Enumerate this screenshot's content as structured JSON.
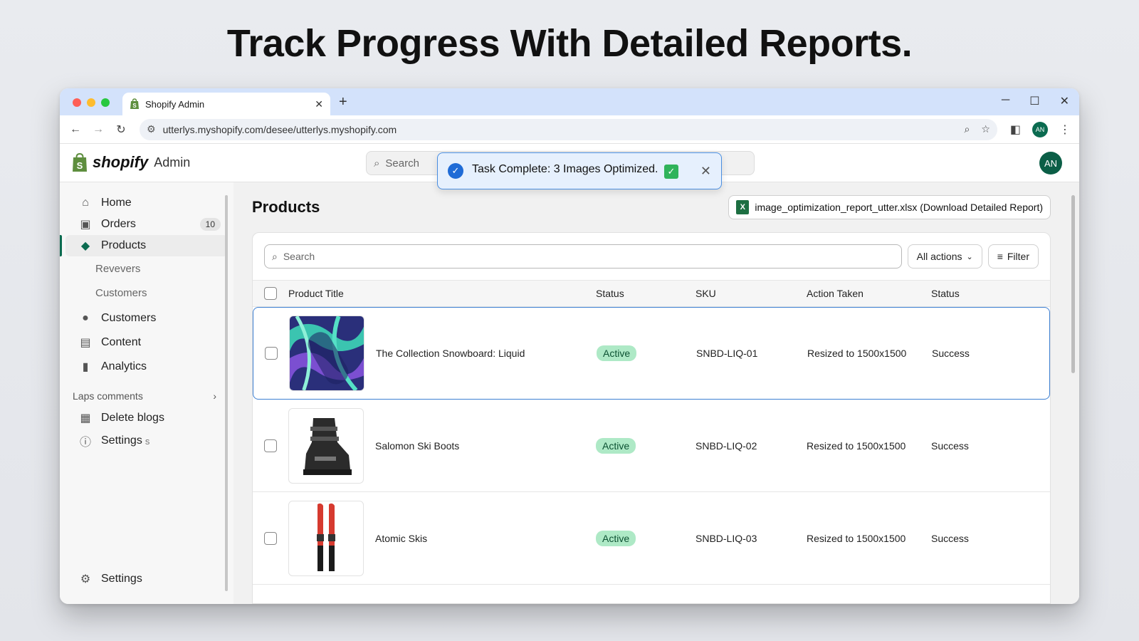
{
  "headline": "Track Progress With Detailed Reports.",
  "browser": {
    "tab_title": "Shopify Admin",
    "url": "utterlys.myshopify.com/desee/utterlys.myshopify.com",
    "profile_initials": "AN"
  },
  "header": {
    "logo_word": "shopify",
    "logo_suffix": "Admin",
    "search_placeholder": "Search",
    "avatar_initials": "AN"
  },
  "toast": {
    "message": "Task Complete: 3 Images Optimized.",
    "emoji": "✓"
  },
  "sidebar": {
    "items": [
      {
        "label": "Home",
        "icon": "home-icon"
      },
      {
        "label": "Orders",
        "icon": "inbox-icon",
        "badge": "10"
      },
      {
        "label": "Products",
        "icon": "tag-icon",
        "active": true
      }
    ],
    "sub_items": [
      "Revevers",
      "Customers"
    ],
    "items2": [
      {
        "label": "Customers",
        "icon": "person-icon"
      },
      {
        "label": "Content",
        "icon": "content-icon"
      },
      {
        "label": "Analytics",
        "icon": "bar-chart-icon"
      }
    ],
    "section_title": "Laps comments",
    "section_items": [
      {
        "label": "Delete blogs",
        "icon": "blog-icon"
      },
      {
        "label": "Settings",
        "suffix": "s",
        "icon": "info-icon"
      }
    ],
    "bottom_settings": "Settings"
  },
  "main": {
    "page_title": "Products",
    "download_label": "image_optimization_report_utter.xlsx (Download Detailed Report)",
    "search_placeholder": "Search",
    "all_actions": "All actions",
    "filter": "Filter",
    "columns": {
      "title": "Product Title",
      "status": "Status",
      "sku": "SKU",
      "action": "Action Taken",
      "result": "Status"
    },
    "rows": [
      {
        "title": "The Collection Snowboard: Liquid",
        "status": "Active",
        "sku": "SNBD-LIQ-01",
        "action": "Resized to 1500x1500",
        "result": "Success"
      },
      {
        "title": "Salomon Ski Boots",
        "status": "Active",
        "sku": "SNBD-LIQ-02",
        "action": "Resized to 1500x1500",
        "result": "Success"
      },
      {
        "title": "Atomic Skis",
        "status": "Active",
        "sku": "SNBD-LIQ-03",
        "action": "Resized to 1500x1500",
        "result": "Success"
      }
    ]
  },
  "colors": {
    "brand_green": "#0b6b50",
    "active_pill": "#aee9c6",
    "toast_border": "#4a8ee0"
  }
}
